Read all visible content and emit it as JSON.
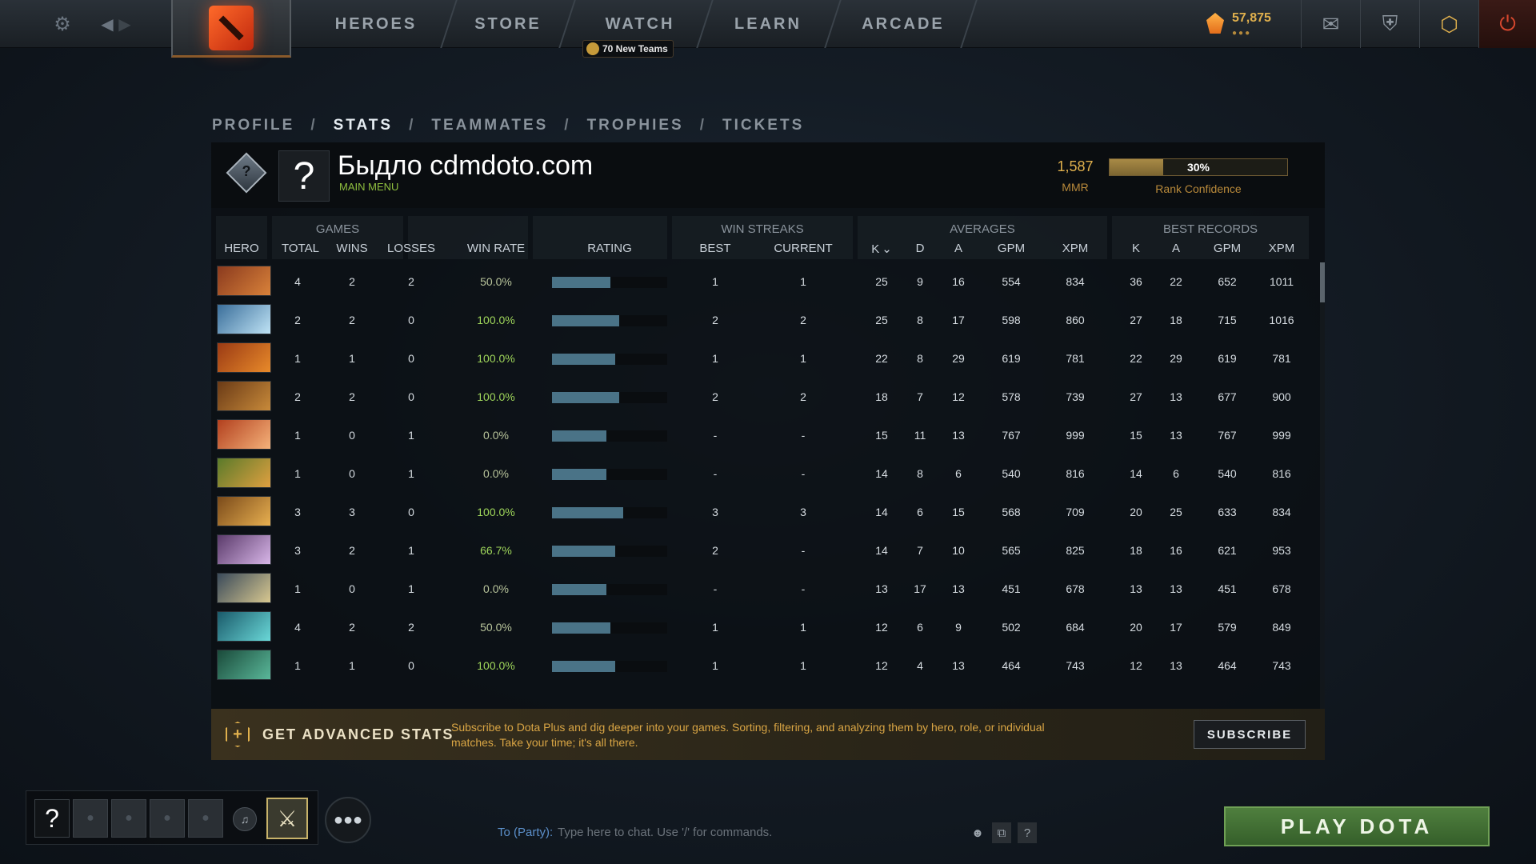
{
  "nav": {
    "items": [
      "HEROES",
      "STORE",
      "WATCH",
      "LEARN",
      "ARCADE"
    ],
    "watch_badge": "70 New Teams"
  },
  "currency": {
    "shards": "57,875"
  },
  "tabs": [
    "PROFILE",
    "STATS",
    "TEAMMATES",
    "TROPHIES",
    "TICKETS"
  ],
  "tab_separator": "/",
  "active_tab": "STATS",
  "profile": {
    "avatar_glyph": "?",
    "rank_glyph": "?",
    "name": "Быдло cdmdoto.com",
    "subtitle": "MAIN MENU",
    "mmr": "1,587",
    "mmr_label": "MMR",
    "rank_confidence": 0.3,
    "rank_confidence_text": "30%",
    "rank_confidence_label": "Rank Confidence"
  },
  "table": {
    "groups": [
      "GAMES",
      "WIN STREAKS",
      "AVERAGES",
      "BEST RECORDS"
    ],
    "columns": [
      "HERO",
      "TOTAL",
      "WINS",
      "LOSSES",
      "WIN RATE",
      "RATING",
      "BEST",
      "CURRENT",
      "K",
      "D",
      "A",
      "GPM",
      "XPM",
      "K",
      "A",
      "GPM",
      "XPM"
    ],
    "sort_indicator": "⌄",
    "rows": [
      {
        "hero_colors": [
          "#8a3a1e",
          "#d9823a"
        ],
        "total": "4",
        "wins": "2",
        "losses": "2",
        "win_rate": "50.0%",
        "rating": 0.51,
        "best": "1",
        "current": "1",
        "k": "25",
        "d": "9",
        "a": "16",
        "gpm": "554",
        "xpm": "834",
        "bk": "36",
        "ba": "22",
        "bgpm": "652",
        "bxpm": "1011"
      },
      {
        "hero_colors": [
          "#3a6e9a",
          "#bfe3f5"
        ],
        "total": "2",
        "wins": "2",
        "losses": "0",
        "win_rate": "100.0%",
        "rating": 0.58,
        "best": "2",
        "current": "2",
        "k": "25",
        "d": "8",
        "a": "17",
        "gpm": "598",
        "xpm": "860",
        "bk": "27",
        "ba": "18",
        "bgpm": "715",
        "bxpm": "1016"
      },
      {
        "hero_colors": [
          "#9a3a14",
          "#e88a2a"
        ],
        "total": "1",
        "wins": "1",
        "losses": "0",
        "win_rate": "100.0%",
        "rating": 0.55,
        "best": "1",
        "current": "1",
        "k": "22",
        "d": "8",
        "a": "29",
        "gpm": "619",
        "xpm": "781",
        "bk": "22",
        "ba": "29",
        "bgpm": "619",
        "bxpm": "781"
      },
      {
        "hero_colors": [
          "#6a3a16",
          "#c88a3a"
        ],
        "total": "2",
        "wins": "2",
        "losses": "0",
        "win_rate": "100.0%",
        "rating": 0.58,
        "best": "2",
        "current": "2",
        "k": "18",
        "d": "7",
        "a": "12",
        "gpm": "578",
        "xpm": "739",
        "bk": "27",
        "ba": "13",
        "bgpm": "677",
        "bxpm": "900"
      },
      {
        "hero_colors": [
          "#b2401e",
          "#f5b27a"
        ],
        "total": "1",
        "wins": "0",
        "losses": "1",
        "win_rate": "0.0%",
        "rating": 0.47,
        "best": "-",
        "current": "-",
        "k": "15",
        "d": "11",
        "a": "13",
        "gpm": "767",
        "xpm": "999",
        "bk": "15",
        "ba": "13",
        "bgpm": "767",
        "bxpm": "999"
      },
      {
        "hero_colors": [
          "#5a7a2a",
          "#e0a040"
        ],
        "total": "1",
        "wins": "0",
        "losses": "1",
        "win_rate": "0.0%",
        "rating": 0.47,
        "best": "-",
        "current": "-",
        "k": "14",
        "d": "8",
        "a": "6",
        "gpm": "540",
        "xpm": "816",
        "bk": "14",
        "ba": "6",
        "bgpm": "540",
        "bxpm": "816"
      },
      {
        "hero_colors": [
          "#7a4a1a",
          "#e8b050"
        ],
        "total": "3",
        "wins": "3",
        "losses": "0",
        "win_rate": "100.0%",
        "rating": 0.62,
        "best": "3",
        "current": "3",
        "k": "14",
        "d": "6",
        "a": "15",
        "gpm": "568",
        "xpm": "709",
        "bk": "20",
        "ba": "25",
        "bgpm": "633",
        "bxpm": "834"
      },
      {
        "hero_colors": [
          "#5a3a6a",
          "#d8b6e8"
        ],
        "total": "3",
        "wins": "2",
        "losses": "1",
        "win_rate": "66.7%",
        "rating": 0.55,
        "best": "2",
        "current": "-",
        "k": "14",
        "d": "7",
        "a": "10",
        "gpm": "565",
        "xpm": "825",
        "bk": "18",
        "ba": "16",
        "bgpm": "621",
        "bxpm": "953"
      },
      {
        "hero_colors": [
          "#3a4a5a",
          "#d8c890"
        ],
        "total": "1",
        "wins": "0",
        "losses": "1",
        "win_rate": "0.0%",
        "rating": 0.47,
        "best": "-",
        "current": "-",
        "k": "13",
        "d": "17",
        "a": "13",
        "gpm": "451",
        "xpm": "678",
        "bk": "13",
        "ba": "13",
        "bgpm": "451",
        "bxpm": "678"
      },
      {
        "hero_colors": [
          "#1a5a6a",
          "#6ad8d8"
        ],
        "total": "4",
        "wins": "2",
        "losses": "2",
        "win_rate": "50.0%",
        "rating": 0.51,
        "best": "1",
        "current": "1",
        "k": "12",
        "d": "6",
        "a": "9",
        "gpm": "502",
        "xpm": "684",
        "bk": "20",
        "ba": "17",
        "bgpm": "579",
        "bxpm": "849"
      },
      {
        "hero_colors": [
          "#1a4a3a",
          "#5ab89a"
        ],
        "total": "1",
        "wins": "1",
        "losses": "0",
        "win_rate": "100.0%",
        "rating": 0.55,
        "best": "1",
        "current": "1",
        "k": "12",
        "d": "4",
        "a": "13",
        "gpm": "464",
        "xpm": "743",
        "bk": "12",
        "ba": "13",
        "bgpm": "464",
        "bxpm": "743"
      }
    ]
  },
  "advanced": {
    "icon_glyph": "+",
    "title": "GET ADVANCED STATS",
    "description": "Subscribe to Dota Plus and dig deeper into your games. Sorting, filtering, and analyzing them by hero, role, or individual matches. Take your time; it's all there.",
    "button": "SUBSCRIBE"
  },
  "party": {
    "empty_slot_glyph": "?"
  },
  "chat": {
    "label": "To (Party):",
    "placeholder": "Type here to chat. Use '/' for commands.",
    "help_glyph": "?"
  },
  "play_button": "PLAY DOTA",
  "colors": {
    "accent_gold": "#e0b04d",
    "rating_bar": "#4a7387",
    "play_green": "#4f7f3e",
    "win_green": "#9ed55a"
  },
  "icons": [
    "gear-icon",
    "back-arrow-icon",
    "forward-arrow-icon",
    "dota-logo-icon",
    "shard-icon",
    "mail-icon",
    "armory-icon",
    "dota-plus-icon",
    "power-icon",
    "voice-icon",
    "invite-icon",
    "community-icon",
    "emoji-icon",
    "screenshot-icon"
  ]
}
